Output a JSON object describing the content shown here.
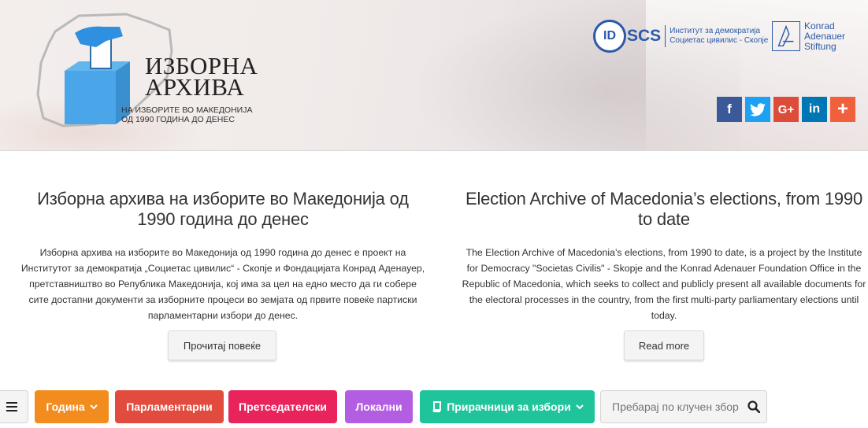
{
  "header": {
    "logo_title_line1": "ИЗБОРНА",
    "logo_title_line2": "АРХИВА",
    "logo_sub_line1": "НА ИЗБОРИТЕ ВО МАКЕДОНИЈА",
    "logo_sub_line2": "ОД 1990 ГОДИНА ДО ДЕНЕС",
    "idscs_logo": "IDSCS",
    "idscs_text_line1": "Институт за демократија",
    "idscs_text_line2": "Социетас цивилис - Скопје",
    "kas_line1": "Konrad",
    "kas_line2": "Adenauer",
    "kas_line3": "Stiftung",
    "social": [
      {
        "name": "facebook",
        "glyph": "f",
        "color": "#3b5998"
      },
      {
        "name": "twitter",
        "glyph": "t",
        "color": "#1da1f2"
      },
      {
        "name": "google-plus",
        "glyph": "G+",
        "color": "#dd4b39"
      },
      {
        "name": "linkedin",
        "glyph": "in",
        "color": "#0077b5"
      },
      {
        "name": "more",
        "glyph": "+",
        "color": "#f0603c"
      }
    ]
  },
  "intro": {
    "mk": {
      "title": "Изборна архива на изборите во Македонија од 1990 година до денес",
      "body": "Изборна архива на изборите во Македонија од 1990 година до денес е проект на Институтот за демократија „Социетас цивилис“ - Скопје и Фондацијата Конрад Аденауер, претставништво во Република Македонија, кој има за цел на едно место да ги собере сите достапни документи за изборните процеси во земјата од првите повеќе партиски парламентарни избори до денес.",
      "button": "Прочитај повеќе"
    },
    "en": {
      "title": "Election Archive of Macedonia’s elections, from 1990 to date",
      "body": "The Election Archive of Macedonia’s elections, from 1990 to date, is a project by the Institute for Democracy \"Societas Civilis\" - Skopje and the Konrad Adenauer Foundation Office in the Republic of Macedonia, which seeks to collect and publicly present all available documents for the electoral processes in the country, from the first multi-party parliamentary elections until today.",
      "button": "Read more"
    }
  },
  "nav": {
    "menu_icon": "hamburger-icon",
    "year": "Година",
    "parliamentary": "Парламентарни",
    "presidential": "Претседателски",
    "local": "Локални",
    "handbooks": "Прирачници за избори",
    "search_placeholder": "Пребарај по клучен збор",
    "colors": {
      "year": "#f28c1e",
      "parliamentary": "#e24c3f",
      "presidential": "#e9245d",
      "local": "#b35de3",
      "handbooks": "#20c49b"
    }
  }
}
